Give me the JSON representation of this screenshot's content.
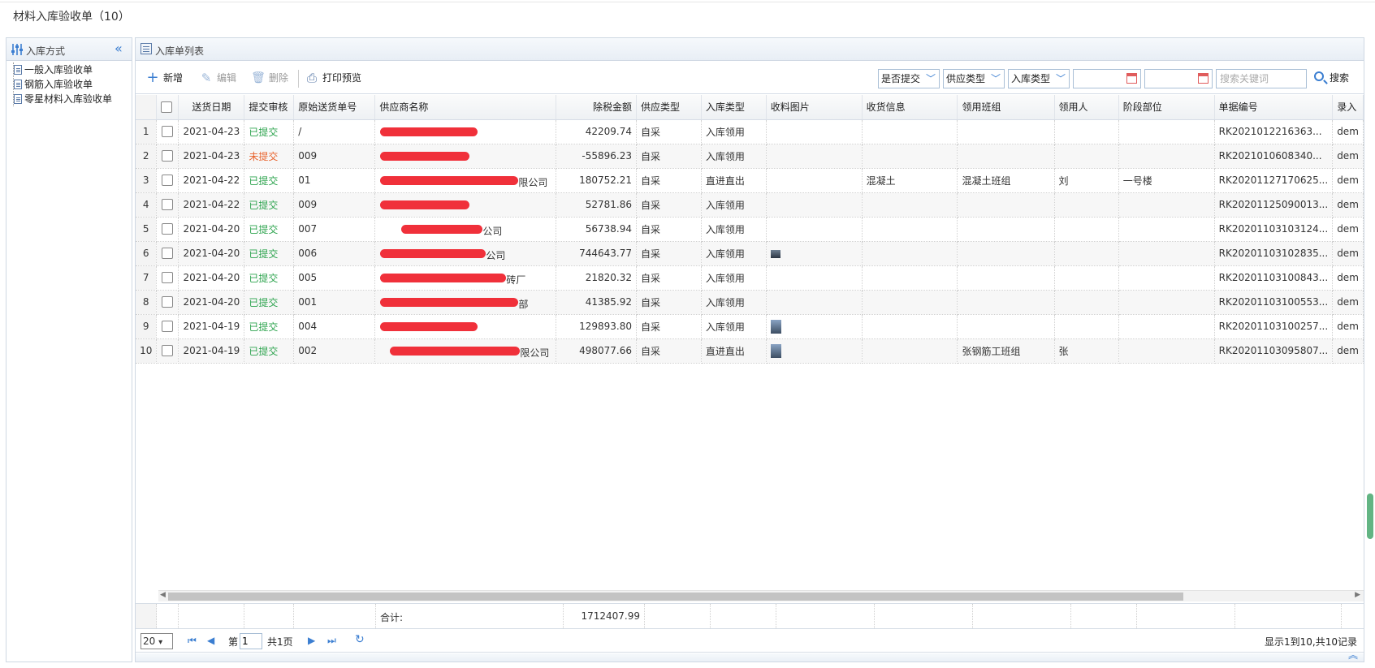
{
  "page": {
    "title": "材料入库验收单（10）"
  },
  "left": {
    "title": "入库方式",
    "items": [
      "一般入库验收单",
      "钢筋入库验收单",
      "零星材料入库验收单"
    ]
  },
  "right": {
    "title": "入库单列表"
  },
  "toolbar": {
    "add": "新增",
    "edit": "编辑",
    "delete": "删除",
    "print": "打印预览",
    "filter_submit": "是否提交",
    "filter_supply": "供应类型",
    "filter_type": "入库类型",
    "search_placeholder": "搜索关键词",
    "search": "搜索"
  },
  "table": {
    "headers": [
      "送货日期",
      "提交审核",
      "原始送货单号",
      "供应商名称",
      "除税金额",
      "供应类型",
      "入库类型",
      "收料图片",
      "收货信息",
      "领用班组",
      "领用人",
      "阶段部位",
      "单据编号",
      "录入"
    ],
    "rows": [
      {
        "n": "1",
        "date": "2021-04-23",
        "status": "已提交",
        "ok": true,
        "orig": "/",
        "supplier": "",
        "amount": "42209.74",
        "supply": "自采",
        "type": "入库领用",
        "img": "",
        "recv": "",
        "team": "",
        "person": "",
        "stage": "",
        "code": "RK2021012216363...",
        "entry": "dem"
      },
      {
        "n": "2",
        "date": "2021-04-23",
        "status": "未提交",
        "ok": false,
        "orig": "009",
        "supplier": "",
        "amount": "-55896.23",
        "supply": "自采",
        "type": "入库领用",
        "img": "",
        "recv": "",
        "team": "",
        "person": "",
        "stage": "",
        "code": "RK2021010608340...",
        "entry": "dem"
      },
      {
        "n": "3",
        "date": "2021-04-22",
        "status": "已提交",
        "ok": true,
        "orig": "01",
        "supplier": "限公司",
        "amount": "180752.21",
        "supply": "自采",
        "type": "直进直出",
        "img": "",
        "recv": "混凝土",
        "team": "混凝土班组",
        "person": "刘",
        "stage": "一号楼",
        "code": "RK20201127170625...",
        "entry": "dem"
      },
      {
        "n": "4",
        "date": "2021-04-22",
        "status": "已提交",
        "ok": true,
        "orig": "009",
        "supplier": "",
        "amount": "52781.86",
        "supply": "自采",
        "type": "入库领用",
        "img": "",
        "recv": "",
        "team": "",
        "person": "",
        "stage": "",
        "code": "RK20201125090013...",
        "entry": "dem"
      },
      {
        "n": "5",
        "date": "2021-04-20",
        "status": "已提交",
        "ok": true,
        "orig": "007",
        "supplier": "公司",
        "amount": "56738.94",
        "supply": "自采",
        "type": "入库领用",
        "img": "",
        "recv": "",
        "team": "",
        "person": "",
        "stage": "",
        "code": "RK20201103103124...",
        "entry": "dem"
      },
      {
        "n": "6",
        "date": "2021-04-20",
        "status": "已提交",
        "ok": true,
        "orig": "006",
        "supplier": "公司",
        "amount": "744643.77",
        "supply": "自采",
        "type": "入库领用",
        "img": "sm",
        "recv": "",
        "team": "",
        "person": "",
        "stage": "",
        "code": "RK20201103102835...",
        "entry": "dem"
      },
      {
        "n": "7",
        "date": "2021-04-20",
        "status": "已提交",
        "ok": true,
        "orig": "005",
        "supplier": "砖厂",
        "amount": "21820.32",
        "supply": "自采",
        "type": "入库领用",
        "img": "",
        "recv": "",
        "team": "",
        "person": "",
        "stage": "",
        "code": "RK20201103100843...",
        "entry": "dem"
      },
      {
        "n": "8",
        "date": "2021-04-20",
        "status": "已提交",
        "ok": true,
        "orig": "001",
        "supplier": "部",
        "amount": "41385.92",
        "supply": "自采",
        "type": "入库领用",
        "img": "",
        "recv": "",
        "team": "",
        "person": "",
        "stage": "",
        "code": "RK20201103100553...",
        "entry": "dem"
      },
      {
        "n": "9",
        "date": "2021-04-19",
        "status": "已提交",
        "ok": true,
        "orig": "004",
        "supplier": "",
        "amount": "129893.80",
        "supply": "自采",
        "type": "入库领用",
        "img": "tall",
        "recv": "",
        "team": "",
        "person": "",
        "stage": "",
        "code": "RK20201103100257...",
        "entry": "dem"
      },
      {
        "n": "10",
        "date": "2021-04-19",
        "status": "已提交",
        "ok": true,
        "orig": "002",
        "supplier": "限公司",
        "amount": "498077.66",
        "supply": "自采",
        "type": "直进直出",
        "img": "tall",
        "recv": "",
        "team": "张钢筋工班组",
        "person": "张",
        "stage": "",
        "code": "RK20201103095807...",
        "entry": "dem"
      }
    ],
    "total_label": "合计:",
    "total_value": "1712407.99"
  },
  "pager": {
    "page_size": "20",
    "page_prefix": "第",
    "page_value": "1",
    "page_suffix": "共1页",
    "summary": "显示1到10,共10记录"
  },
  "colors": {
    "accent": "#3b7ed1",
    "submitted": "#2ea44f",
    "unsubmitted": "#e8632d",
    "redaction": "#f0303a"
  }
}
